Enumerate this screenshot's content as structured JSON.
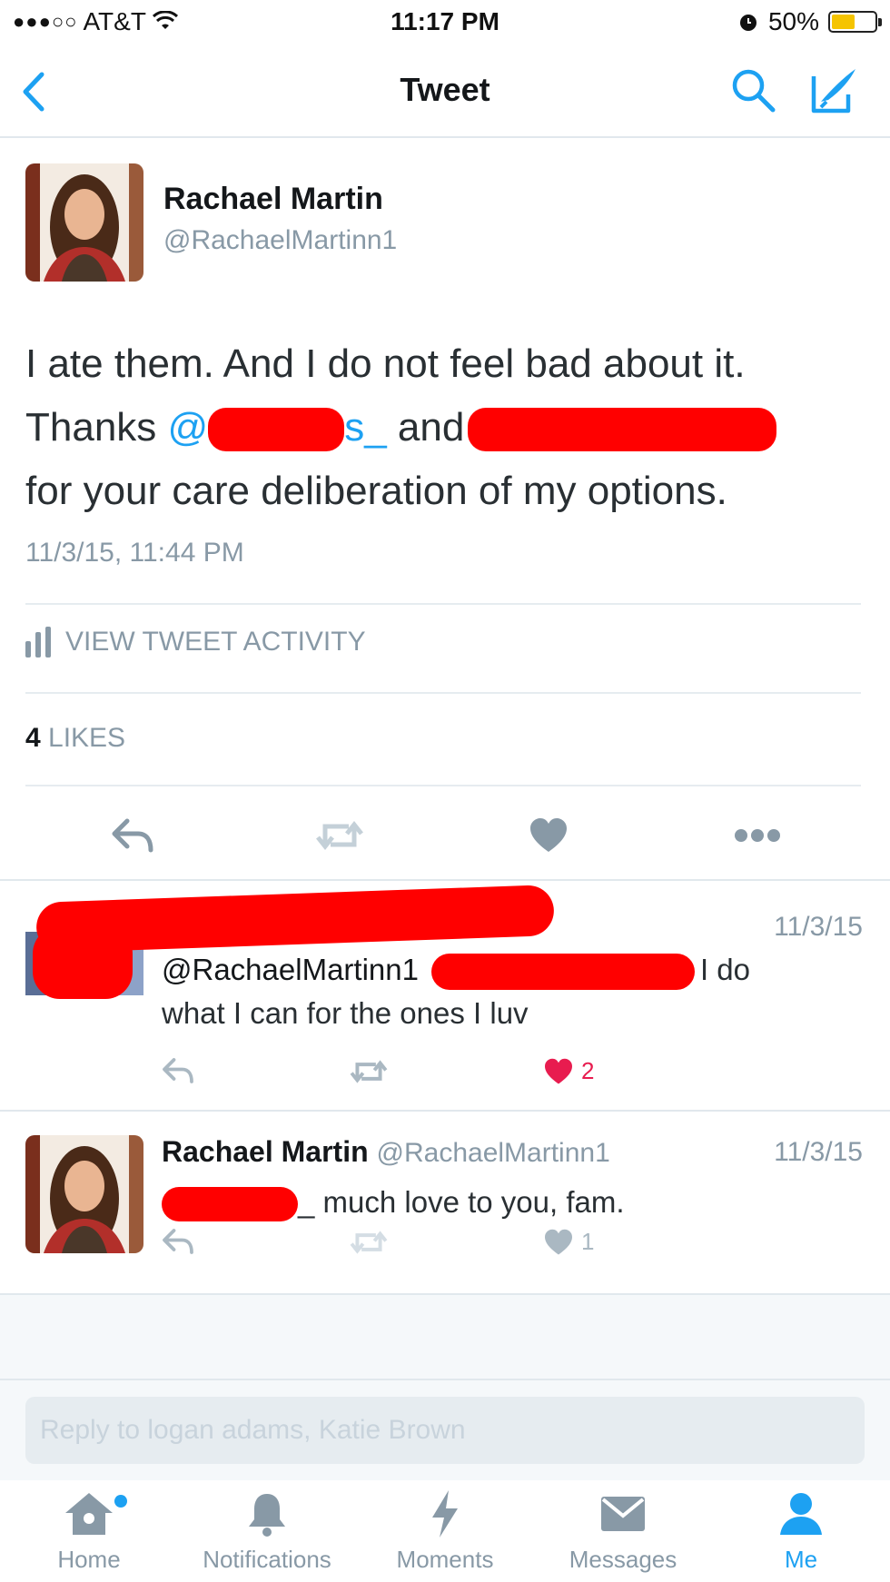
{
  "status_bar": {
    "carrier": "AT&T",
    "time": "11:17 PM",
    "battery_percent": "50%",
    "battery_level": 0.5
  },
  "nav": {
    "title": "Tweet",
    "icons": [
      "back-chevron-icon",
      "search-icon",
      "compose-icon"
    ],
    "accent": "#1da1f2"
  },
  "main_tweet": {
    "author_name": "Rachael Martin",
    "author_handle": "@RachaelMartinn1",
    "text_line1": "I ate them. And I do not feel bad about it.",
    "text_thanks": "Thanks ",
    "mention1_visible": "@",
    "mention1_suffix": "s_",
    "text_and": " and",
    "text_line3": "for your care deliberation of my options.",
    "date": "11/3/15, 11:44 PM",
    "activity_label": "VIEW TWEET ACTIVITY",
    "likes_count": "4",
    "likes_label": " LIKES"
  },
  "replies": [
    {
      "date": "11/3/15",
      "text_handle": "@RachaelMartinn1",
      "text_tail": "I do",
      "text_line2": "what I can for the ones I luv",
      "like_count": "2",
      "liked": true
    },
    {
      "author_name": "Rachael Martin",
      "author_handle": "@RachaelMartinn1",
      "date": "11/3/15",
      "text_prefix": "_",
      "text": " much love to you, fam.",
      "like_count": "1",
      "liked": false
    }
  ],
  "reply_box": {
    "placeholder": "Reply to logan adams, Katie Brown"
  },
  "tabs": [
    {
      "label": "Home",
      "icon": "home-icon",
      "active": false
    },
    {
      "label": "Notifications",
      "icon": "bell-icon",
      "active": false
    },
    {
      "label": "Moments",
      "icon": "lightning-icon",
      "active": false
    },
    {
      "label": "Messages",
      "icon": "envelope-icon",
      "active": false
    },
    {
      "label": "Me",
      "icon": "person-icon",
      "active": true
    }
  ],
  "colors": {
    "redaction": "#ff0000",
    "like_red": "#e81c4f",
    "muted": "#8899a6"
  }
}
